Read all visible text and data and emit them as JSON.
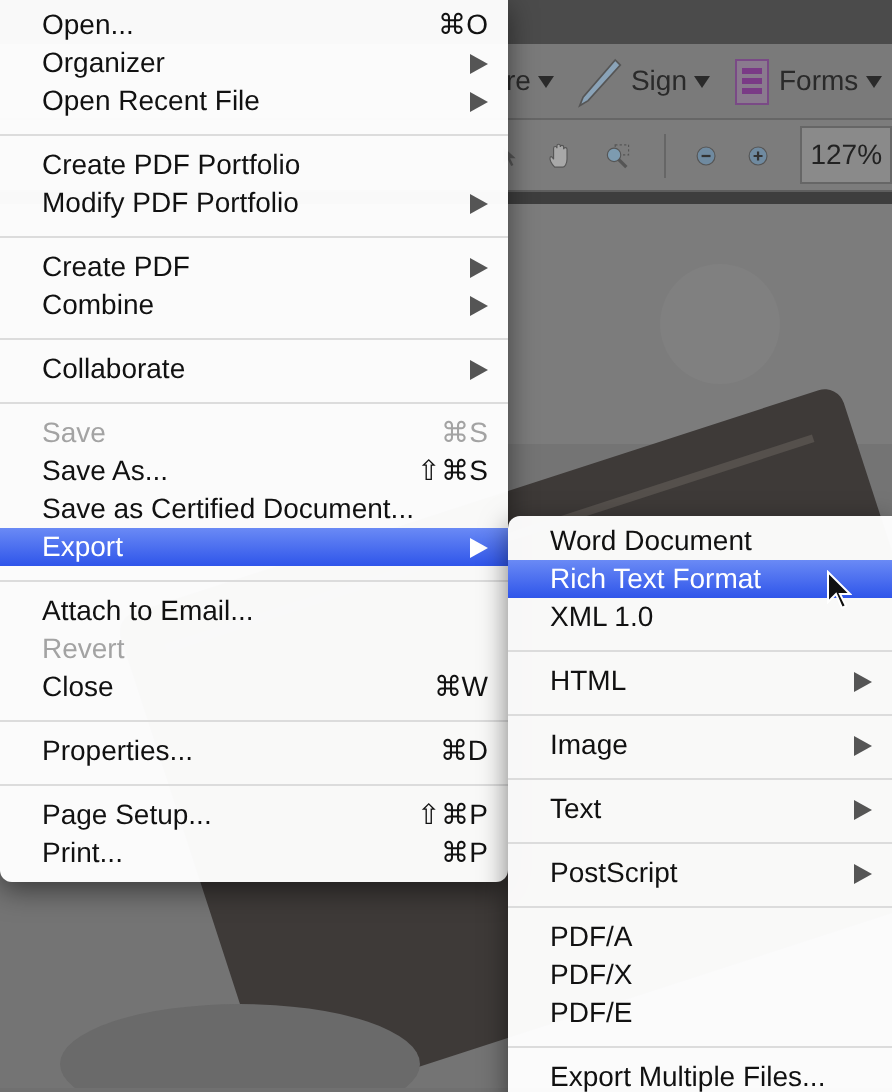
{
  "toolbar": {
    "tools": [
      {
        "kind": "text",
        "label": "re"
      },
      {
        "kind": "pen",
        "label": "Sign"
      },
      {
        "kind": "form",
        "label": "Forms"
      }
    ]
  },
  "view_toolbar": {
    "zoom": "127%"
  },
  "file_menu": {
    "items": [
      {
        "kind": "item",
        "label": "Open...",
        "shortcut": "⌘O",
        "submenu": false,
        "disabled": false,
        "selected": false
      },
      {
        "kind": "item",
        "label": "Organizer",
        "submenu": true,
        "disabled": false,
        "selected": false
      },
      {
        "kind": "item",
        "label": "Open Recent File",
        "submenu": true,
        "disabled": false,
        "selected": false
      },
      {
        "kind": "separator"
      },
      {
        "kind": "item",
        "label": "Create PDF Portfolio",
        "submenu": false,
        "disabled": false,
        "selected": false
      },
      {
        "kind": "item",
        "label": "Modify PDF Portfolio",
        "submenu": true,
        "disabled": false,
        "selected": false
      },
      {
        "kind": "separator"
      },
      {
        "kind": "item",
        "label": "Create PDF",
        "submenu": true,
        "disabled": false,
        "selected": false
      },
      {
        "kind": "item",
        "label": "Combine",
        "submenu": true,
        "disabled": false,
        "selected": false
      },
      {
        "kind": "separator"
      },
      {
        "kind": "item",
        "label": "Collaborate",
        "submenu": true,
        "disabled": false,
        "selected": false
      },
      {
        "kind": "separator"
      },
      {
        "kind": "item",
        "label": "Save",
        "shortcut": "⌘S",
        "submenu": false,
        "disabled": true,
        "selected": false
      },
      {
        "kind": "item",
        "label": "Save As...",
        "shortcut": "⇧⌘S",
        "submenu": false,
        "disabled": false,
        "selected": false
      },
      {
        "kind": "item",
        "label": "Save as Certified Document...",
        "submenu": false,
        "disabled": false,
        "selected": false
      },
      {
        "kind": "item",
        "label": "Export",
        "submenu": true,
        "disabled": false,
        "selected": true
      },
      {
        "kind": "separator"
      },
      {
        "kind": "item",
        "label": "Attach to Email...",
        "submenu": false,
        "disabled": false,
        "selected": false
      },
      {
        "kind": "item",
        "label": "Revert",
        "submenu": false,
        "disabled": true,
        "selected": false
      },
      {
        "kind": "item",
        "label": "Close",
        "shortcut": "⌘W",
        "submenu": false,
        "disabled": false,
        "selected": false
      },
      {
        "kind": "separator"
      },
      {
        "kind": "item",
        "label": "Properties...",
        "shortcut": "⌘D",
        "submenu": false,
        "disabled": false,
        "selected": false
      },
      {
        "kind": "separator"
      },
      {
        "kind": "item",
        "label": "Page Setup...",
        "shortcut": "⇧⌘P",
        "submenu": false,
        "disabled": false,
        "selected": false
      },
      {
        "kind": "item",
        "label": "Print...",
        "shortcut": "⌘P",
        "submenu": false,
        "disabled": false,
        "selected": false
      }
    ]
  },
  "export_submenu": {
    "items": [
      {
        "kind": "item",
        "label": "Word Document",
        "submenu": false,
        "disabled": false,
        "selected": false
      },
      {
        "kind": "item",
        "label": "Rich Text Format",
        "submenu": false,
        "disabled": false,
        "selected": true
      },
      {
        "kind": "item",
        "label": "XML 1.0",
        "submenu": false,
        "disabled": false,
        "selected": false
      },
      {
        "kind": "separator"
      },
      {
        "kind": "item",
        "label": "HTML",
        "submenu": true,
        "disabled": false,
        "selected": false
      },
      {
        "kind": "separator"
      },
      {
        "kind": "item",
        "label": "Image",
        "submenu": true,
        "disabled": false,
        "selected": false
      },
      {
        "kind": "separator"
      },
      {
        "kind": "item",
        "label": "Text",
        "submenu": true,
        "disabled": false,
        "selected": false
      },
      {
        "kind": "separator"
      },
      {
        "kind": "item",
        "label": "PostScript",
        "submenu": true,
        "disabled": false,
        "selected": false
      },
      {
        "kind": "separator"
      },
      {
        "kind": "item",
        "label": "PDF/A",
        "submenu": false,
        "disabled": false,
        "selected": false
      },
      {
        "kind": "item",
        "label": "PDF/X",
        "submenu": false,
        "disabled": false,
        "selected": false
      },
      {
        "kind": "item",
        "label": "PDF/E",
        "submenu": false,
        "disabled": false,
        "selected": false
      },
      {
        "kind": "separator"
      },
      {
        "kind": "item",
        "label": "Export Multiple Files...",
        "submenu": false,
        "disabled": false,
        "selected": false
      }
    ]
  }
}
